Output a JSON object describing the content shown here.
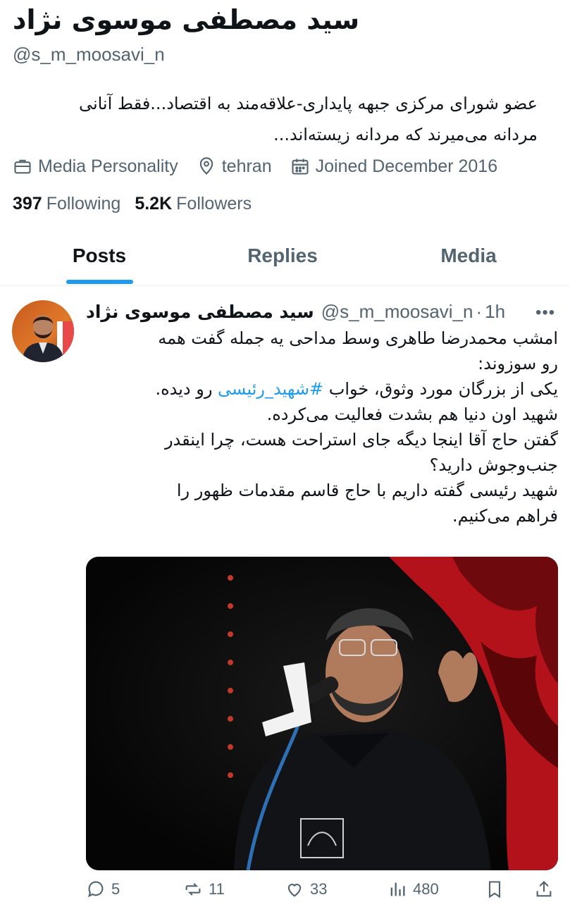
{
  "profile": {
    "name": "سید مصطفی موسوی نژاد",
    "handle": "@s_m_moosavi_n",
    "bio_line1": "عضو شورای مرکزی جبهه پایداری-علاقه‌مند به اقتصاد...فقط آنانی",
    "bio_line2": "مردانه می‌میرند که مردانه زیسته‌اند...",
    "category": "Media Personality",
    "location": "tehran",
    "joined": "Joined December 2016",
    "following_count": "397",
    "following_label": "Following",
    "followers_count": "5.2K",
    "followers_label": "Followers"
  },
  "tabs": [
    {
      "label": "Posts",
      "active": true
    },
    {
      "label": "Replies",
      "active": false
    },
    {
      "label": "Media",
      "active": false
    }
  ],
  "tweet": {
    "author_name": "سید مصطفی موسوی نژاد",
    "author_handle": "@s_m_moosavi_n",
    "separator": "·",
    "time": "1h",
    "more": "•••",
    "lines": {
      "l1": "امشب محمدرضا طاهری وسط مداحی یه جمله گفت همه",
      "l2": "رو سوزوند:",
      "l3_pre": "یکی از بزرگان مورد وثوق، خواب ",
      "l3_tag": "#شهید_رئیسی",
      "l3_post": " رو دیده.",
      "l4": "شهید اون دنیا هم بشدت فعالیت می‌کرده.",
      "l5": "گفتن حاج آقا اینجا دیگه جای استراحت هست، چرا اینقدر",
      "l6": "جنب‌وجوش دارید؟",
      "l7": "شهید رئیسی گفته داریم با حاج قاسم مقدمات ظهور را",
      "l8": "فراهم می‌کنیم."
    },
    "stats": {
      "replies": "5",
      "reposts": "11",
      "likes": "33",
      "views": "480"
    }
  },
  "colors": {
    "accent": "#1d9bf0",
    "secondary_text": "#536471",
    "primary_text": "#0f1419"
  }
}
